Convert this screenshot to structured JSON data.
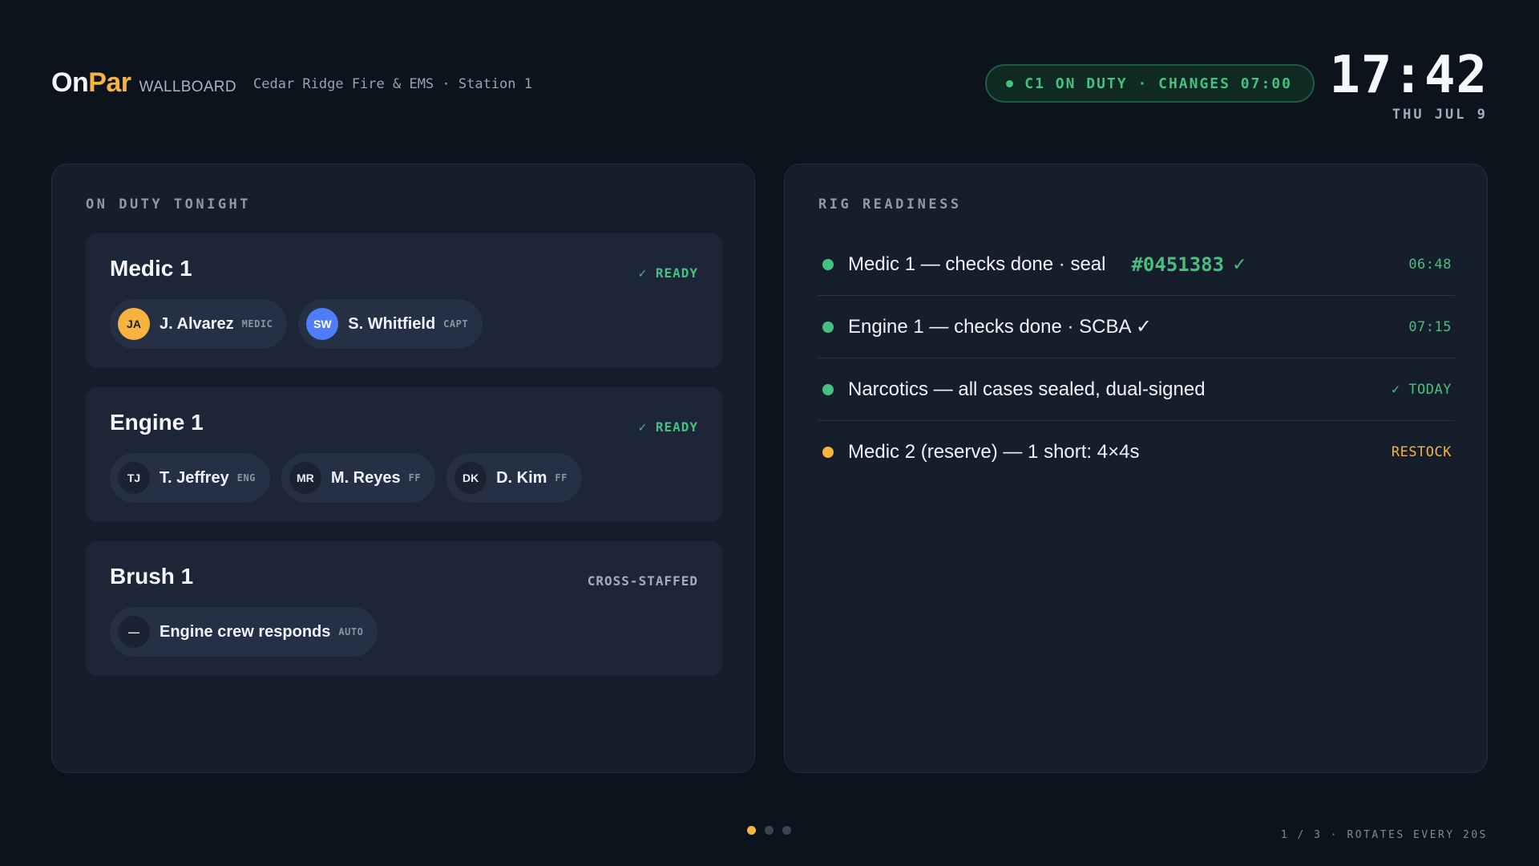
{
  "header": {
    "brand_on": "On",
    "brand_par": "Par",
    "brand_suffix": "WALLBOARD",
    "station": "Cedar Ridge Fire & EMS · Station 1",
    "duty_status": "C1 ON DUTY · CHANGES 07:00",
    "clock": "17:42",
    "date": "THU JUL 9"
  },
  "on_duty": {
    "title": "ON DUTY TONIGHT",
    "units": [
      {
        "name": "Medic 1",
        "status": "✓ READY",
        "crew": [
          {
            "initials": "JA",
            "name": "J. Alvarez",
            "role": "MEDIC"
          },
          {
            "initials": "SW",
            "name": "S. Whitfield",
            "role": "CAPT"
          }
        ]
      },
      {
        "name": "Engine 1",
        "status": "✓ READY",
        "crew": [
          {
            "initials": "TJ",
            "name": "T. Jeffrey",
            "role": "ENG"
          },
          {
            "initials": "MR",
            "name": "M. Reyes",
            "role": "FF"
          },
          {
            "initials": "DK",
            "name": "D. Kim",
            "role": "FF"
          }
        ]
      },
      {
        "name": "Brush 1",
        "status": "CROSS-STAFFED",
        "crew": [
          {
            "initials": "—",
            "name": "Engine crew responds",
            "role": "AUTO"
          }
        ]
      }
    ]
  },
  "rig_readiness": {
    "title": "RIG READINESS",
    "items": [
      {
        "text": "Medic 1 — checks done · seal",
        "seal": "#0451383",
        "seal_check": "✓",
        "meta": "06:48",
        "state": "ok"
      },
      {
        "text": "Engine 1 — checks done · SCBA ✓",
        "meta": "07:15",
        "state": "ok"
      },
      {
        "text": "Narcotics — all cases sealed, dual-signed",
        "meta": "✓ TODAY",
        "state": "ok"
      },
      {
        "text": "Medic 2 (reserve) — 1 short: 4×4s",
        "meta": "RESTOCK",
        "state": "warn"
      }
    ]
  },
  "footer": {
    "page_count": 3,
    "active_page": 1,
    "rotation": "1 / 3 · ROTATES EVERY 20S"
  },
  "colors": {
    "accent": "#f4b43f",
    "ok": "#45c07e",
    "background": "#0d131d",
    "panel": "#161e2b"
  }
}
